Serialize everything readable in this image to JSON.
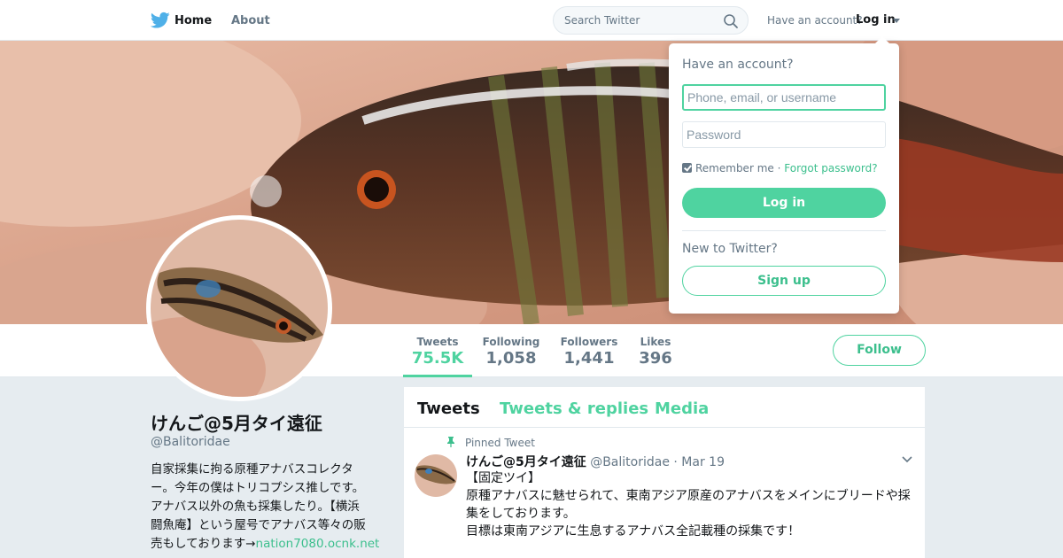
{
  "colors": {
    "accent": "#4fd3a0",
    "accent_text": "#3cbf8d",
    "muted": "#657786",
    "text": "#14171a",
    "background": "#e6ecf0"
  },
  "nav": {
    "logo_icon": "twitter-bird-icon",
    "home": "Home",
    "about": "About",
    "search_placeholder": "Search Twitter",
    "search_icon": "search-icon",
    "have_account": "Have an account?",
    "login": "Log in",
    "caret_icon": "caret-down-icon"
  },
  "login_dropdown": {
    "title": "Have an account?",
    "username_placeholder": "Phone, email, or username",
    "password_placeholder": "Password",
    "remember_me": "Remember me",
    "separator": "·",
    "forgot_password": "Forgot password?",
    "remember_checked": true,
    "login_button": "Log in",
    "new_to": "New to Twitter?",
    "signup_button": "Sign up"
  },
  "stats": [
    {
      "label": "Tweets",
      "value": "75.5K",
      "active": true
    },
    {
      "label": "Following",
      "value": "1,058",
      "active": false
    },
    {
      "label": "Followers",
      "value": "1,441",
      "active": false
    },
    {
      "label": "Likes",
      "value": "396",
      "active": false
    }
  ],
  "follow_button": "Follow",
  "profile": {
    "name": "けんご@5月タイ遠征",
    "handle": "@Balitoridae",
    "bio_lines": [
      "自家採集に拘る原種アナバスコレクタ",
      "ー。今年の僕はトリコプシス推しです。",
      "アナバス以外の魚も採集したり。【横浜",
      "闘魚庵】という屋号でアナバス等々の販"
    ],
    "bio_last_text": "売もしております→",
    "bio_link": "nation7080.ocnk.net"
  },
  "timeline": {
    "tabs": [
      {
        "label": "Tweets",
        "active": true
      },
      {
        "label": "Tweets & replies",
        "active": false
      },
      {
        "label": "Media",
        "active": false
      }
    ],
    "pinned_tweet": {
      "pin_icon": "pin-icon",
      "pinned_label": "Pinned Tweet",
      "name": "けんご@5月タイ遠征",
      "handle": "@Balitoridae",
      "date": "· Mar 19",
      "chevron_icon": "chevron-down-icon",
      "lines": [
        "【固定ツイ】",
        "原種アナバスに魅せられて、東南アジア原産のアナバスをメインにブリードや採",
        "集をしております。",
        "目標は東南アジアに生息するアナバス全記載種の採集です！"
      ]
    }
  }
}
